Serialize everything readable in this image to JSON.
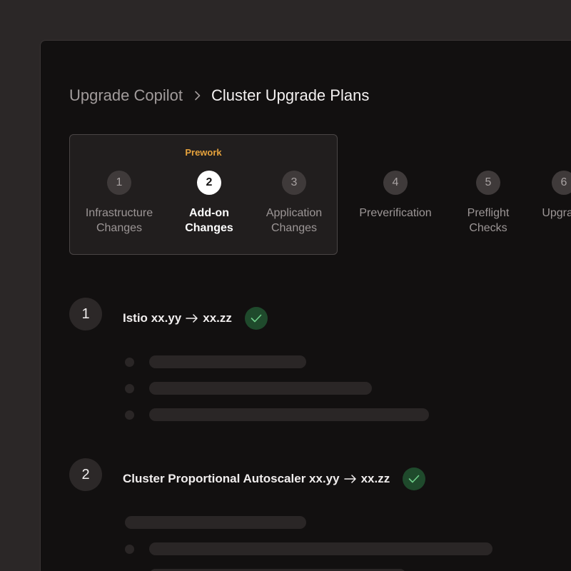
{
  "breadcrumb": {
    "parent": "Upgrade Copilot",
    "current": "Cluster Upgrade Plans",
    "separator_icon": "chevron-right-icon"
  },
  "stepper": {
    "group_label": "Prework",
    "active_step": 2,
    "steps": [
      {
        "number": "1",
        "label": "Infrastructure\nChanges"
      },
      {
        "number": "2",
        "label": "Add-on\nChanges"
      },
      {
        "number": "3",
        "label": "Application\nChanges"
      },
      {
        "number": "4",
        "label": "Preverification"
      },
      {
        "number": "5",
        "label": "Preflight\nChecks"
      },
      {
        "number": "6",
        "label": "Upgrade"
      }
    ]
  },
  "tasks": [
    {
      "number": "1",
      "name": "Istio",
      "from_version": "xx.yy",
      "to_version": "xx.zz",
      "status_icon": "check-icon"
    },
    {
      "number": "2",
      "name": "Cluster Proportional Autoscaler",
      "from_version": "xx.yy",
      "to_version": "xx.zz",
      "status_icon": "check-icon"
    }
  ],
  "colors": {
    "background": "#2b2727",
    "panel": "#121010",
    "accent": "#e6a23c",
    "success": "#1f4a2c",
    "success_check": "#6fcf8a"
  }
}
